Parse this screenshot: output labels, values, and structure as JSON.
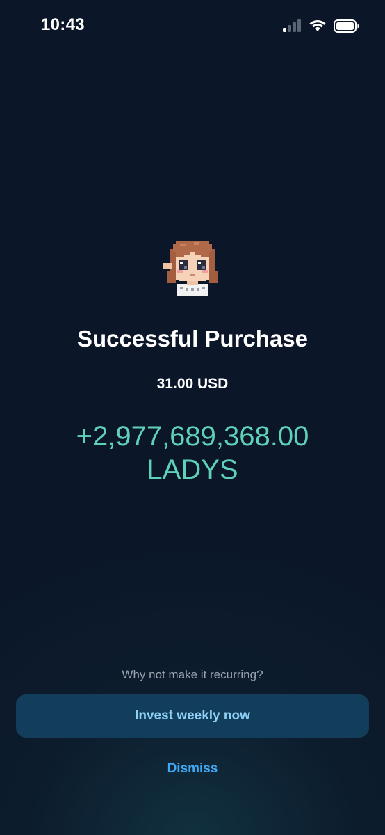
{
  "status_bar": {
    "time": "10:43",
    "icons": [
      "cellular-signal-icon",
      "wifi-icon",
      "battery-icon"
    ]
  },
  "purchase": {
    "avatar_icon": "ladys-token-avatar-icon",
    "title": "Successful Purchase",
    "usd_amount": "31.00 USD",
    "token_amount": "+2,977,689,368.00",
    "token_symbol": "LADYS"
  },
  "actions": {
    "prompt": "Why not make it recurring?",
    "invest_label": "Invest weekly now",
    "dismiss_label": "Dismiss"
  },
  "colors": {
    "background": "#0b1628",
    "token_amount": "#5fd1b8",
    "invest_button_bg": "#123e5b",
    "invest_button_text": "#8fd0f5",
    "dismiss_text": "#3fa9f5",
    "prompt_text": "#9ba3ae"
  }
}
